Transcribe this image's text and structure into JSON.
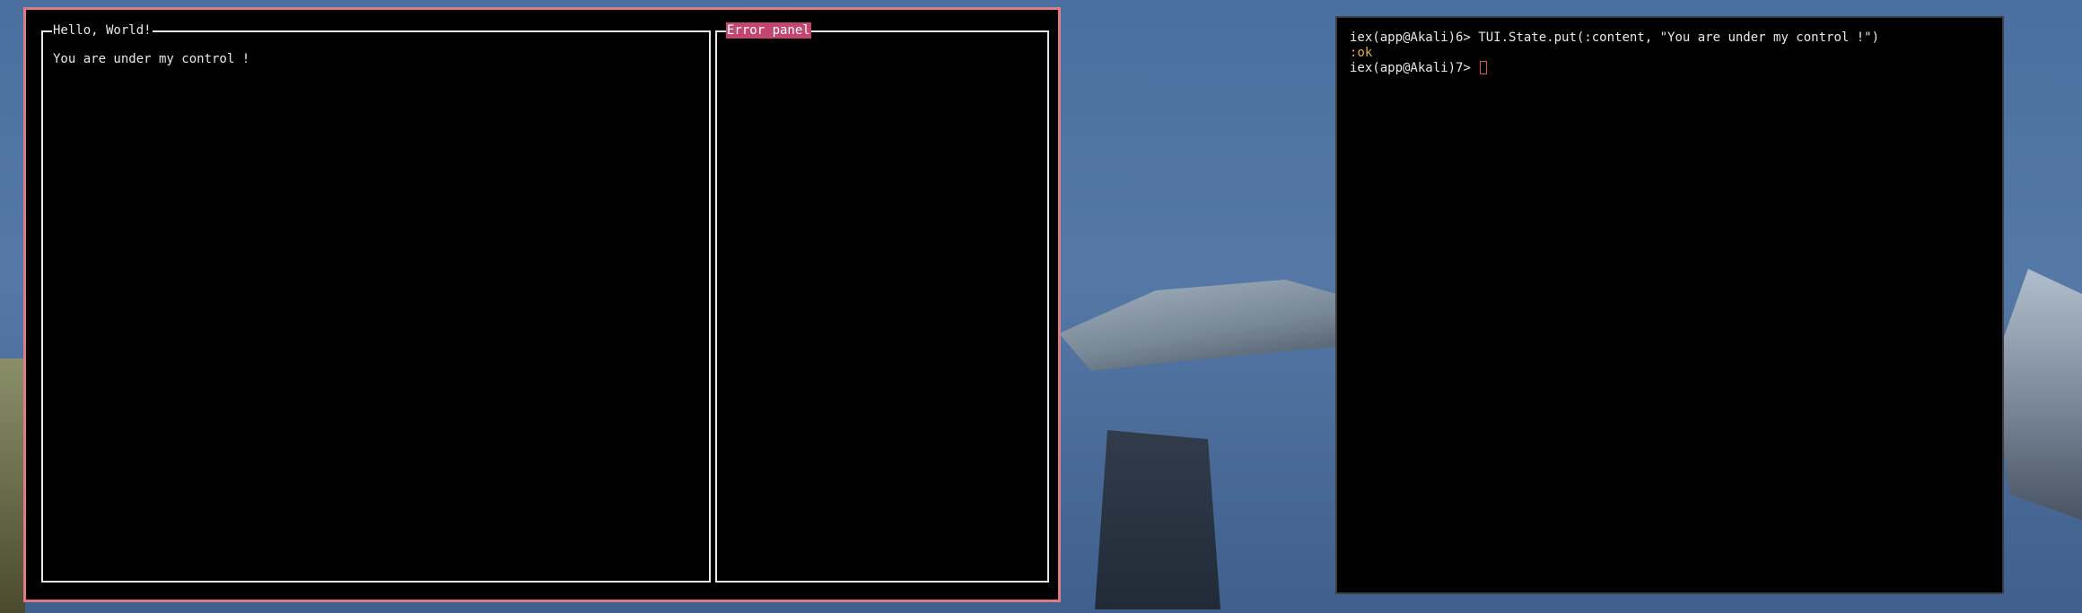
{
  "tui": {
    "left_pane": {
      "title": "Hello, World!",
      "content": "You are under my control !"
    },
    "right_pane": {
      "title": "Error panel"
    },
    "border_color": "#e07a85",
    "error_title_bg": "#c2466e"
  },
  "terminal": {
    "lines": [
      {
        "prompt": "iex(app@Akali)6> ",
        "input": "TUI.State.put(:content, \"You are under my control !\")"
      },
      {
        "output": ":ok"
      },
      {
        "prompt": "iex(app@Akali)7> ",
        "input": ""
      }
    ],
    "ok_color": "#e0b040",
    "cursor_color": "#e05050"
  }
}
